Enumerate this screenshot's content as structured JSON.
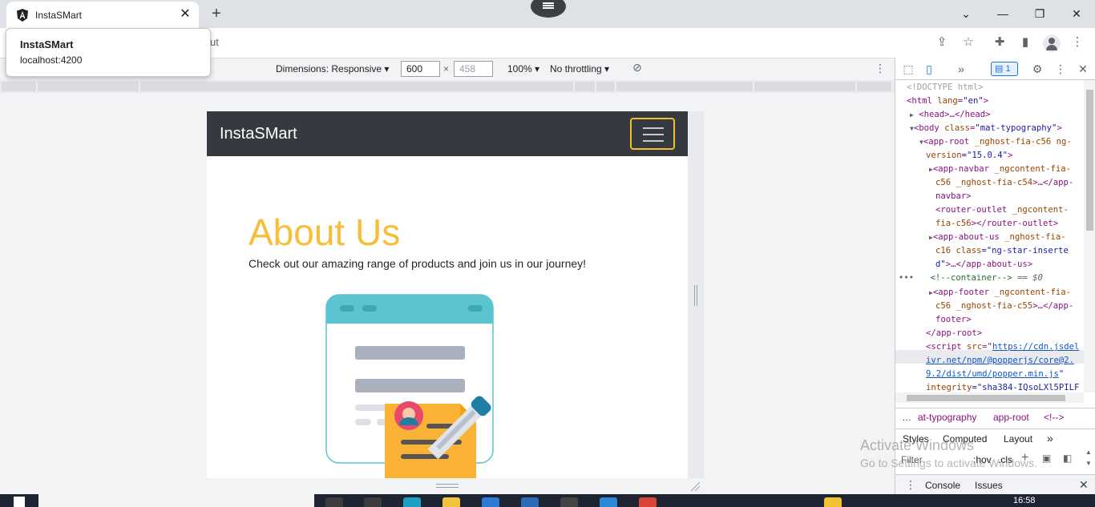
{
  "browser": {
    "tab_title": "InstaSMart",
    "new_tab_symbol": "+",
    "omnibox_tail": "ut",
    "tooltip": {
      "title": "InstaSMart",
      "url": "localhost:4200"
    }
  },
  "device_toolbar": {
    "dimensions_label": "Dimensions: Responsive",
    "width": "600",
    "times": "×",
    "height_placeholder": "458",
    "zoom": "100%",
    "throttling": "No throttling"
  },
  "page": {
    "brand": "InstaSMart",
    "about_title": "About Us",
    "about_text": "Check out our amazing range of products and join us in our journey!"
  },
  "devtools": {
    "issues_count": "1",
    "dom": {
      "doctype": "<!DOCTYPE html>",
      "html_open_tag": "<html ",
      "html_attr": "lang",
      "html_val": "\"en\"",
      "html_close": ">",
      "head": "<head>…</head>",
      "body_tag": "<body ",
      "body_attr": "class",
      "body_val": "\"mat-typography\"",
      "body_close": ">",
      "approot_1": "<app-root ",
      "approot_attr1": "_nghost-fia-c56",
      "approot_attr2": " ng-",
      "approot_2a": "version",
      "approot_2b": "=\"15.0.4\"",
      "approot_2c": ">",
      "navbar_1": "<app-navbar ",
      "navbar_1b": "_ngcontent-fia-",
      "navbar_2": "c56 _nghost-fia-c54",
      "navbar_2b": ">…</app-",
      "navbar_3": "navbar>",
      "router_1": "<router-outlet ",
      "router_1b": "_ngcontent-",
      "router_2": "fia-c56",
      "router_2b": "></router-outlet>",
      "about_1": "<app-about-us ",
      "about_1b": "_nghost-fia-",
      "about_2": "c16 ",
      "about_2b": "class",
      "about_2c": "=\"ng-star-inserte",
      "about_3": "d\"",
      "about_3b": ">…</app-about-us>",
      "comment": "<!--container-->",
      "selected_marker": " == $0",
      "footer_1": "<app-footer ",
      "footer_1b": "_ngcontent-fia-",
      "footer_2": "c56 _nghost-fia-c55",
      "footer_2b": ">…</app-",
      "footer_3": "footer>",
      "approot_close": "</app-root>",
      "script_1": "<script ",
      "script_1b": "src",
      "script_1c": "=\"",
      "script_link_1": "https://cdn.jsdel",
      "script_link_2": "ivr.net/npm/@popperjs/core@2.",
      "script_link_3": "9.2/dist/umd/popper.min.js",
      "script_3b": "\"",
      "script_4a": "integrity",
      "script_4b": "=\"sha384-IQsoLXl5PILF"
    },
    "breadcrumbs": [
      "…",
      "at-typography",
      "app-root",
      "<!-->"
    ],
    "styles_tabs": [
      "Styles",
      "Computed",
      "Layout",
      "»"
    ],
    "filter_label": "Filter",
    "hov": ":hov",
    "cls": ".cls",
    "add_symbol": "+",
    "drawer_tabs": [
      "Console",
      "Issues"
    ]
  },
  "watermark": {
    "line1": "Activate Windows",
    "line2": "Go to Settings to activate Windows."
  },
  "taskbar": {
    "clock": "16:58"
  },
  "colors": {
    "navbar_bg": "#343a40",
    "about_title": "#f6be39",
    "toggler_border": "#f5bd2e",
    "accent_blue": "#1a73e8"
  }
}
